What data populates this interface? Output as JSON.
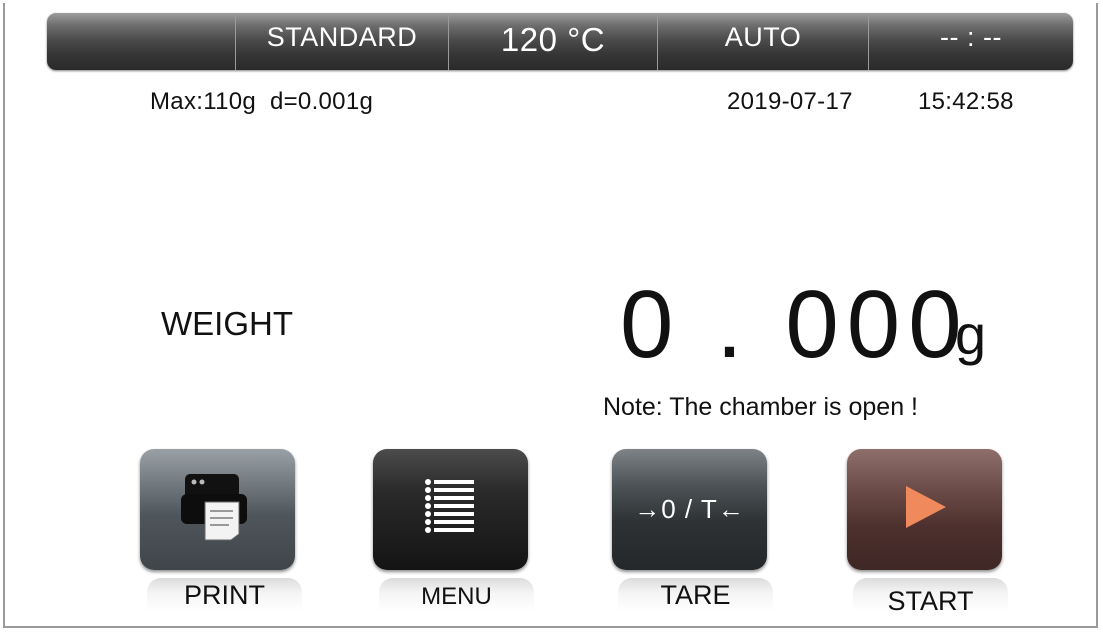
{
  "status_bar": {
    "blank_label": "",
    "mode": "STANDARD",
    "temperature": "120 °C",
    "switch_mode": "AUTO",
    "timer": "-- : --"
  },
  "info": {
    "capacity": "Max:110g  d=0.001g",
    "date": "2019-07-17",
    "time": "15:42:58"
  },
  "display": {
    "label": "WEIGHT",
    "value": "0 . 000",
    "unit": "g",
    "note": "Note: The chamber is open !"
  },
  "buttons": {
    "print": {
      "label": "PRINT",
      "icon": "printer-icon"
    },
    "menu": {
      "label": "MENU",
      "icon": "list-icon"
    },
    "tare": {
      "label": "TARE",
      "symbol": "→0 / T←"
    },
    "start": {
      "label": "START",
      "icon": "play-icon"
    }
  },
  "colors": {
    "play_icon": "#f08a5d",
    "print_button": "#5a6166",
    "menu_button": "#1e1e1e",
    "tare_button": "#363b3e",
    "start_button": "#553835"
  }
}
